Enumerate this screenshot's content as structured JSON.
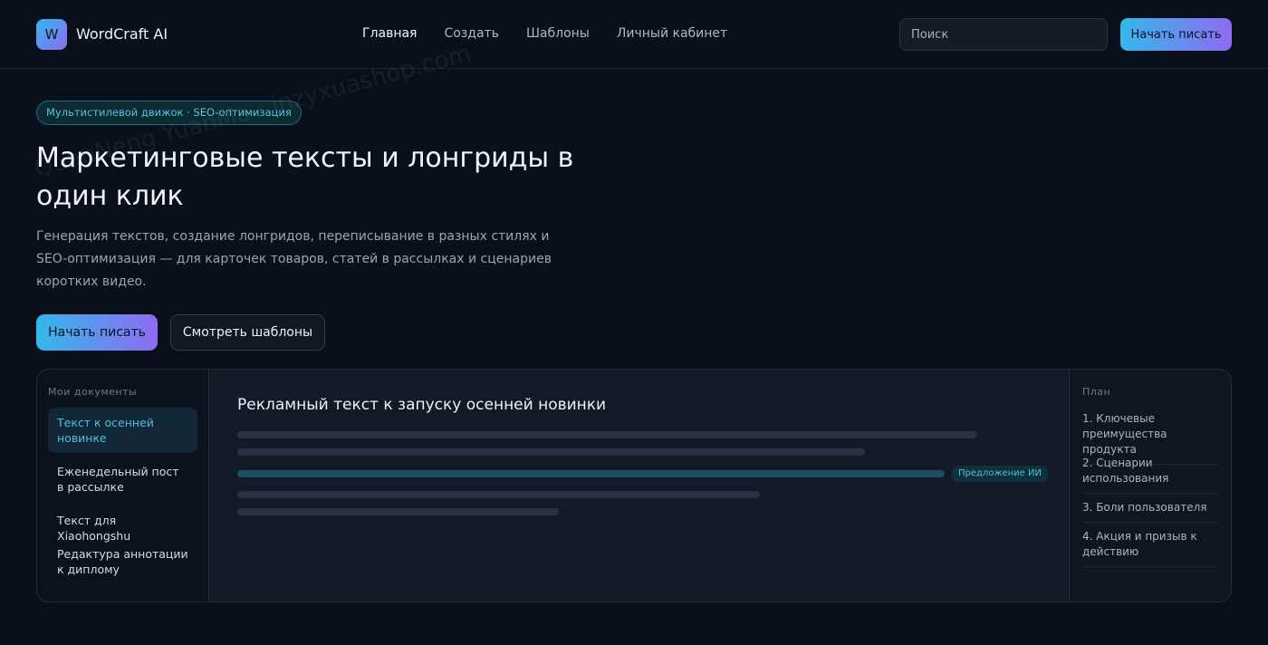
{
  "header": {
    "logo_letter": "W",
    "brand": "WordCraft AI",
    "nav": [
      {
        "label": "Главная",
        "active": true
      },
      {
        "label": "Создать",
        "active": false
      },
      {
        "label": "Шаблоны",
        "active": false
      },
      {
        "label": "Личный кабинет",
        "active": false
      }
    ],
    "search_placeholder": "Поиск",
    "cta_label": "Начать писать"
  },
  "hero": {
    "tag": "Мультистилевой движок · SEO-оптимизация",
    "title": "Маркетинговые тексты и лонгриды в один клик",
    "description": "Генерация текстов, создание лонгридов, переписывание в разных стилях и SEO-оптимизация — для карточек товаров, статей в рассылках и сценариев коротких видео.",
    "primary_button": "Начать писать",
    "secondary_button": "Смотреть шаблоны"
  },
  "workspace": {
    "docs_label": "Мои документы",
    "docs": [
      {
        "label": "Текст к осенней новинке",
        "active": true
      },
      {
        "label": "Еженедельный пост в рассылке",
        "active": false
      },
      {
        "label": "Текст для Xiaohongshu",
        "active": false
      },
      {
        "label": "Редактура аннотации к диплому",
        "active": false
      }
    ],
    "editor_title": "Рекламный текст к запуску осенней новинки",
    "ai_badge": "Предложение ИИ",
    "plan_label": "План",
    "plan": [
      "1. Ключевые преимущества продукта",
      "2. Сценарии использования",
      "3. Боли пользователя",
      "4. Акция и призыв к действию"
    ]
  },
  "watermark": "QuanNeng YuanMa · inzyxuashop.com",
  "colors": {
    "background": "#0a101b",
    "accent_start": "#34b8ea",
    "accent_end": "#8f6bf1",
    "teal_text": "#4fc0dc"
  }
}
